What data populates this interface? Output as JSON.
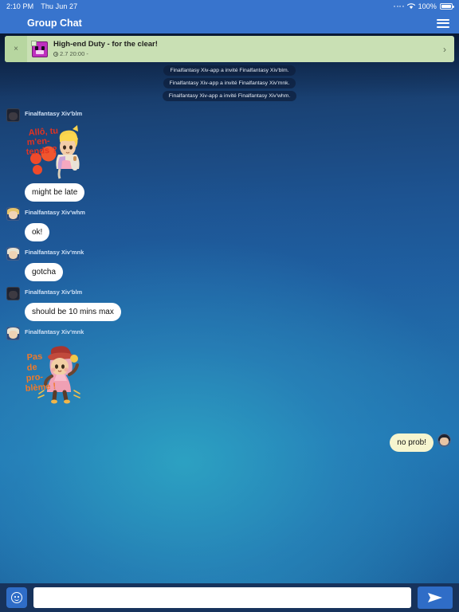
{
  "status_bar": {
    "time": "2:10 PM",
    "date": "Thu Jun 27",
    "battery_percent": "100%",
    "wifi_icon": "wifi-icon",
    "battery_icon": "battery-icon",
    "signal_icon": "signal-dots-icon"
  },
  "nav": {
    "back_icon": "chevron-left-icon",
    "title": "Group Chat",
    "menu_icon": "hamburger-menu-icon"
  },
  "banner": {
    "close_label": "×",
    "icon_name": "duty-monster-icon",
    "title": "High-end Duty - for the clear!",
    "time": "2.7 20:00 -",
    "chevron": "›"
  },
  "system_messages": [
    "Finalfantasy Xiv-app a invité Finalfantasy Xiv'blm.",
    "Finalfantasy Xiv-app a invité Finalfantasy Xiv'mnk.",
    "Finalfantasy Xiv-app a invité Finalfantasy Xiv'whm."
  ],
  "messages": [
    {
      "sender": "Finalfantasy Xiv'blm",
      "type": "sticker",
      "sticker_name": "allo-tu-mentends-sticker",
      "sticker_text": "Allô, tu m'en-tends ?"
    },
    {
      "sender": "",
      "type": "text",
      "text": "might be late"
    },
    {
      "sender": "Finalfantasy Xiv'whm",
      "type": "text",
      "text": "ok!"
    },
    {
      "sender": "Finalfantasy Xiv'mnk",
      "type": "text",
      "text": "gotcha"
    },
    {
      "sender": "Finalfantasy Xiv'blm",
      "type": "text",
      "text": "should be 10 mins max"
    },
    {
      "sender": "Finalfantasy Xiv'mnk",
      "type": "sticker",
      "sticker_name": "pas-de-probleme-sticker",
      "sticker_text": "Pas de pro-blème !"
    },
    {
      "sender": "me",
      "type": "text",
      "text": "no prob!",
      "outgoing": true
    }
  ],
  "input_bar": {
    "emoji_icon": "emoji-smiley-icon",
    "input_value": "",
    "input_placeholder": "",
    "send_icon": "send-paper-plane-icon"
  },
  "colors": {
    "nav_blue": "#3874cd",
    "banner_green": "#c9e0b4",
    "bubble_white": "#ffffff",
    "bubble_mine": "#f6f5cf",
    "input_bar": "#17335c"
  }
}
